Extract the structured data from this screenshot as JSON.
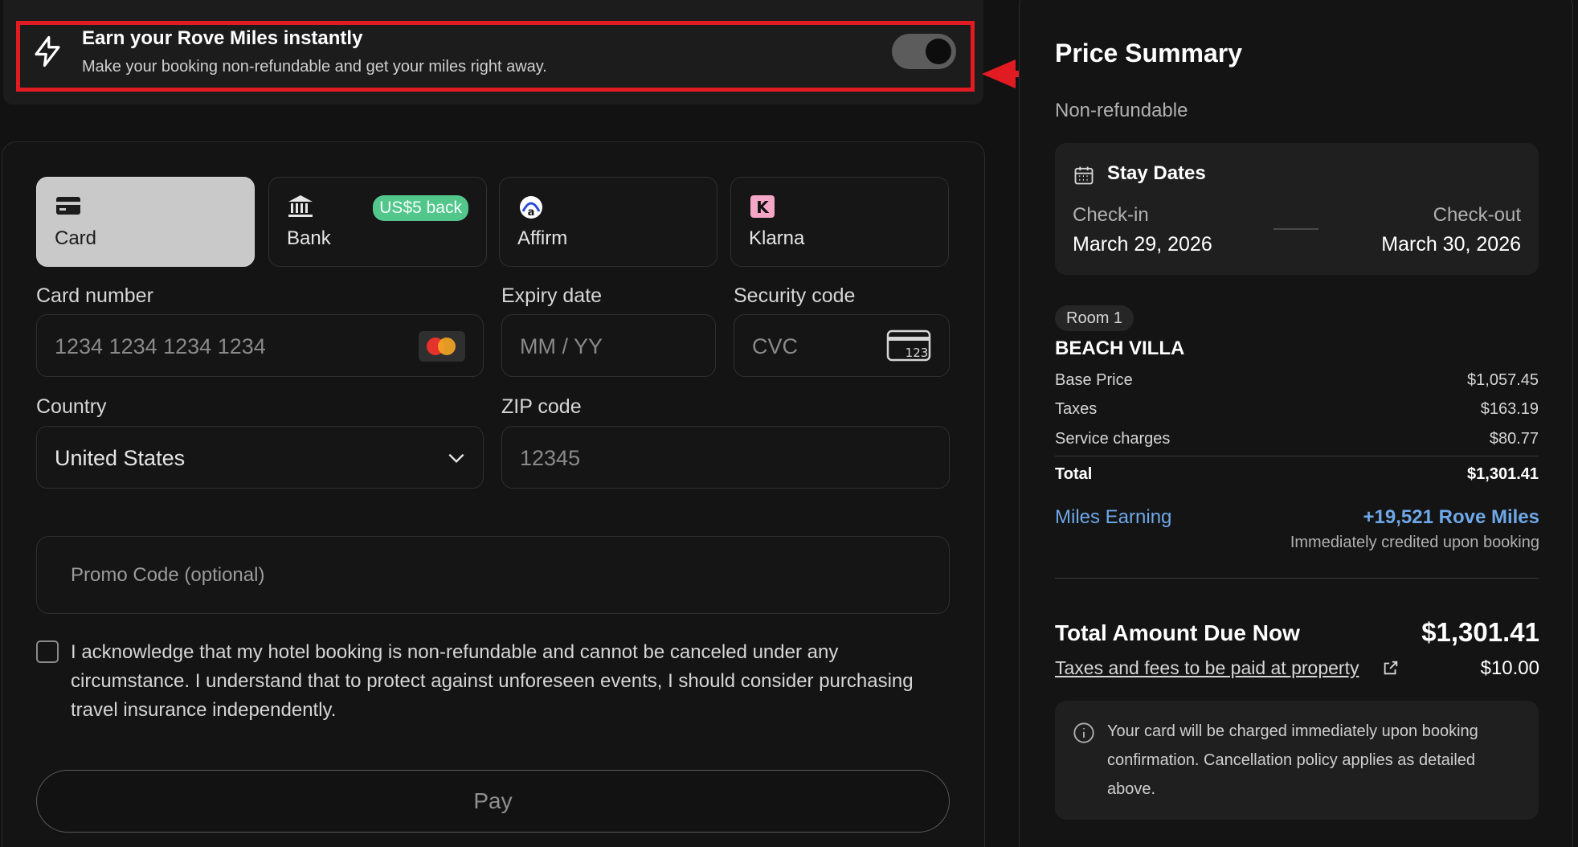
{
  "banner": {
    "title": "Earn your Rove Miles instantly",
    "subtitle": "Make your booking non-refundable and get your miles right away.",
    "toggle_on": true,
    "highlight_color": "#e11b22"
  },
  "payment_methods": [
    {
      "label": "Card",
      "icon": "credit-card-icon",
      "active": true
    },
    {
      "label": "Bank",
      "icon": "bank-icon",
      "badge": "US$5 back"
    },
    {
      "label": "Affirm",
      "icon": "affirm-icon"
    },
    {
      "label": "Klarna",
      "icon": "klarna-icon"
    }
  ],
  "form": {
    "card_number_label": "Card number",
    "card_number_placeholder": "1234 1234 1234 1234",
    "expiry_label": "Expiry date",
    "expiry_placeholder": "MM / YY",
    "security_label": "Security code",
    "security_placeholder": "CVC",
    "cvc_icon_text": "123",
    "country_label": "Country",
    "country_value": "United States",
    "zip_label": "ZIP code",
    "zip_placeholder": "12345",
    "promo_placeholder": "Promo Code (optional)",
    "ack_text": "I acknowledge that my hotel booking is non-refundable and cannot be canceled under any circumstance. I understand that to protect against unforeseen events, I should consider purchasing travel insurance independently.",
    "pay_label": "Pay"
  },
  "summary": {
    "title": "Price Summary",
    "refund_policy": "Non-refundable",
    "stay_dates_title": "Stay Dates",
    "checkin_label": "Check-in",
    "checkin_value": "March 29, 2026",
    "checkout_label": "Check-out",
    "checkout_value": "March 30, 2026",
    "room_pill": "Room 1",
    "room_name": "BEACH VILLA",
    "rows": [
      {
        "label": "Base Price",
        "value": "$1,057.45"
      },
      {
        "label": "Taxes",
        "value": "$163.19"
      },
      {
        "label": "Service charges",
        "value": "$80.77"
      },
      {
        "label": "Total",
        "value": "$1,301.41"
      }
    ],
    "miles_label": "Miles Earning",
    "miles_value": "+19,521 Rove Miles",
    "miles_note": "Immediately credited upon booking",
    "due_label": "Total Amount Due Now",
    "due_value": "$1,301.41",
    "taxes_link": "Taxes and fees to be paid at property",
    "taxes_value": "$10.00",
    "notice": "Your card will be charged immediately upon booking confirmation. Cancellation policy applies as detailed above.",
    "accent_color": "#6ea8e8"
  }
}
